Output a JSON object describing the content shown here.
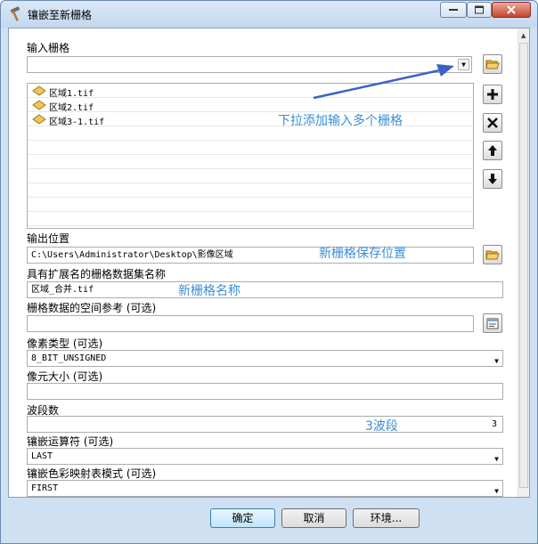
{
  "window": {
    "title": "镶嵌至新栅格"
  },
  "fields": {
    "input_rasters": {
      "label": "输入栅格",
      "value": "",
      "items": [
        "区域1.tif",
        "区域2.tif",
        "区域3-1.tif"
      ]
    },
    "output_location": {
      "label": "输出位置",
      "value": "C:\\Users\\Administrator\\Desktop\\影像区域"
    },
    "raster_name": {
      "label": "具有扩展名的栅格数据集名称",
      "value": "区域_合并.tif"
    },
    "spatial_reference": {
      "label": "栅格数据的空间参考 (可选)",
      "value": ""
    },
    "pixel_type": {
      "label": "像素类型 (可选)",
      "value": "8_BIT_UNSIGNED"
    },
    "cellsize": {
      "label": "像元大小 (可选)",
      "value": ""
    },
    "bands": {
      "label": "波段数",
      "value": "3"
    },
    "mosaic_operator": {
      "label": "镶嵌运算符 (可选)",
      "value": "LAST"
    },
    "colormap_mode": {
      "label": "镶嵌色彩映射表模式 (可选)",
      "value": "FIRST"
    }
  },
  "annotations": {
    "dropdown_hint": "下拉添加输入多个栅格",
    "save_hint": "新栅格保存位置",
    "name_hint": "新栅格名称",
    "bands_hint": "3波段"
  },
  "buttons": {
    "ok": "确定",
    "cancel": "取消",
    "env": "环境..."
  },
  "icons": {
    "app": "hammer-icon",
    "folder": "folder-open-icon",
    "add": "plus-icon",
    "remove": "x-icon",
    "up": "arrow-up-icon",
    "down": "arrow-down-icon",
    "spatial_ref": "properties-icon"
  },
  "colors": {
    "annotation": "#3b8ed8",
    "arrow": "#3a63c8"
  }
}
